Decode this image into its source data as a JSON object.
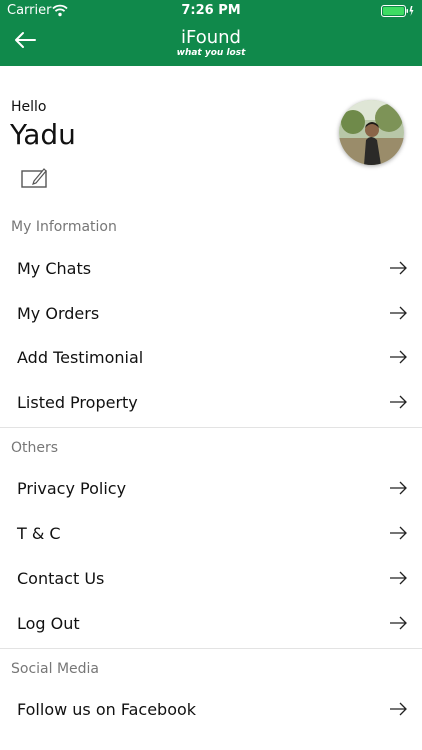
{
  "status_bar": {
    "carrier": "Carrier",
    "time": "7:26 PM"
  },
  "header": {
    "title": "iFound",
    "subtitle": "what you lost"
  },
  "profile": {
    "greeting": "Hello",
    "name": "Yadu"
  },
  "sections": [
    {
      "title": "My Information",
      "items": [
        "My Chats",
        "My Orders",
        "Add Testimonial",
        "Listed Property"
      ]
    },
    {
      "title": "Others",
      "items": [
        "Privacy Policy",
        "T & C",
        "Contact Us",
        "Log Out"
      ]
    },
    {
      "title": "Social Media",
      "items": [
        "Follow us on Facebook"
      ]
    }
  ],
  "icons": {
    "back": "back-arrow-icon",
    "edit": "edit-icon",
    "row": "right-arrow-icon"
  },
  "colors": {
    "header_green": "#10894b",
    "section_text": "#777777"
  }
}
